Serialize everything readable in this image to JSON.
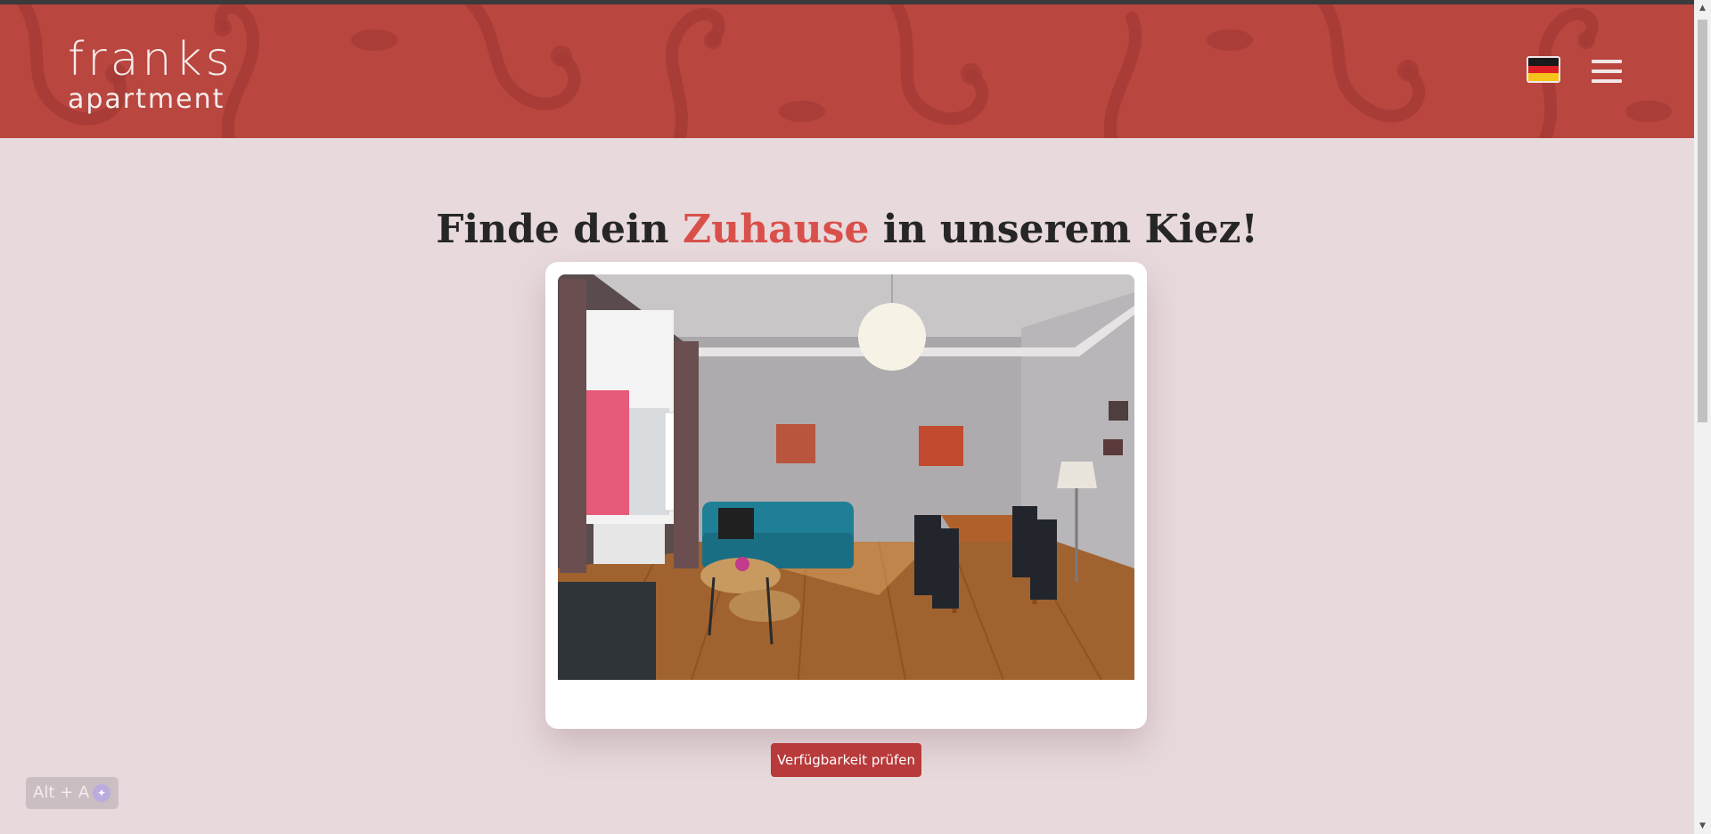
{
  "header": {
    "logo_main": "franks",
    "logo_sub": "apartment",
    "flag_colors": [
      "#1a1a1a",
      "#dd1f26",
      "#f5c31b"
    ],
    "language_icon": "german-flag-icon",
    "menu_icon": "hamburger-menu-icon"
  },
  "hero": {
    "headline_before": "Finde dein",
    "headline_accent": "Zuhause",
    "headline_after": "in unserem Kiez!",
    "accent_color": "#d9504b",
    "image_alt": "Wohnzimmer mit blauem Sofa, Esstisch und Holzboden",
    "cta_label": "Verfügbarkeit prüfen"
  },
  "accessibility": {
    "shortcut_label": "Alt + A",
    "icon": "accessibility-icon"
  },
  "colors": {
    "header_red": "#b9463f",
    "page_bg": "#e8dadc",
    "button_red": "#b83a3a"
  }
}
